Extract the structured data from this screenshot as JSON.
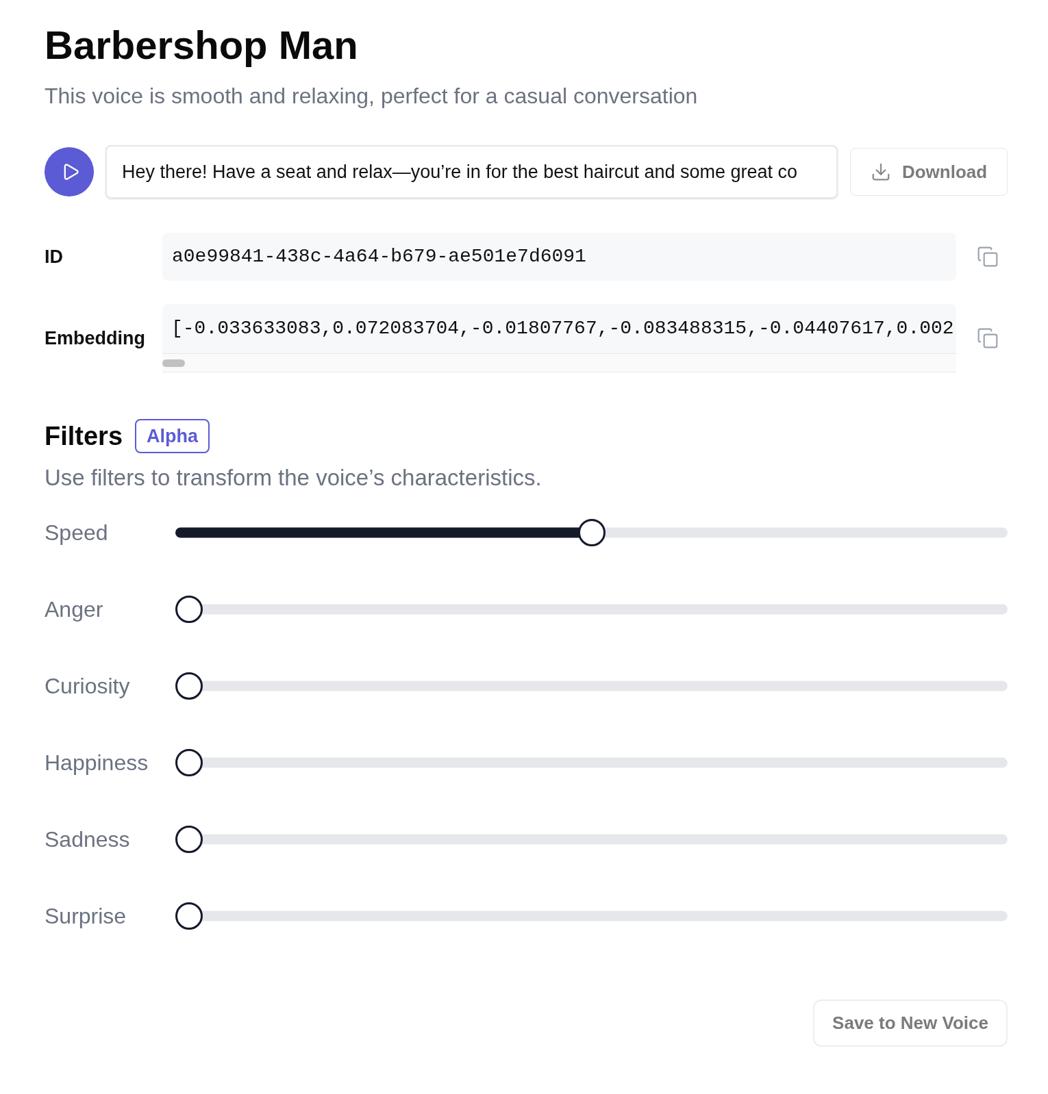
{
  "voice": {
    "title": "Barbershop Man",
    "description": "This voice is smooth and relaxing, perfect for a casual conversation"
  },
  "preview": {
    "value": "Hey there! Have a seat and relax—you’re in for the best haircut and some great co",
    "download": {
      "label": "Download",
      "disabled": true
    }
  },
  "details": [
    {
      "kind": "plain",
      "label": "ID",
      "value": "a0e99841-438c-4a64-b679-ae501e7d6091"
    },
    {
      "kind": "scrollable",
      "label": "Embedding",
      "value": "[-0.033633083,0.072083704,-0.01807767,-0.083488315,-0.04407617,0.002"
    }
  ],
  "filters": {
    "title": "Filters",
    "badge": "Alpha",
    "description": "Use filters to transform the voice’s characteristics.",
    "sliders": [
      {
        "name": "Speed",
        "level": 0.5
      },
      {
        "name": "Anger",
        "level": 0
      },
      {
        "name": "Curiosity",
        "level": 0
      },
      {
        "name": "Happiness",
        "level": 0
      },
      {
        "name": "Sadness",
        "level": 0
      },
      {
        "name": "Surprise",
        "level": 0
      }
    ]
  },
  "save": {
    "label": "Save to New Voice",
    "disabled": true
  }
}
